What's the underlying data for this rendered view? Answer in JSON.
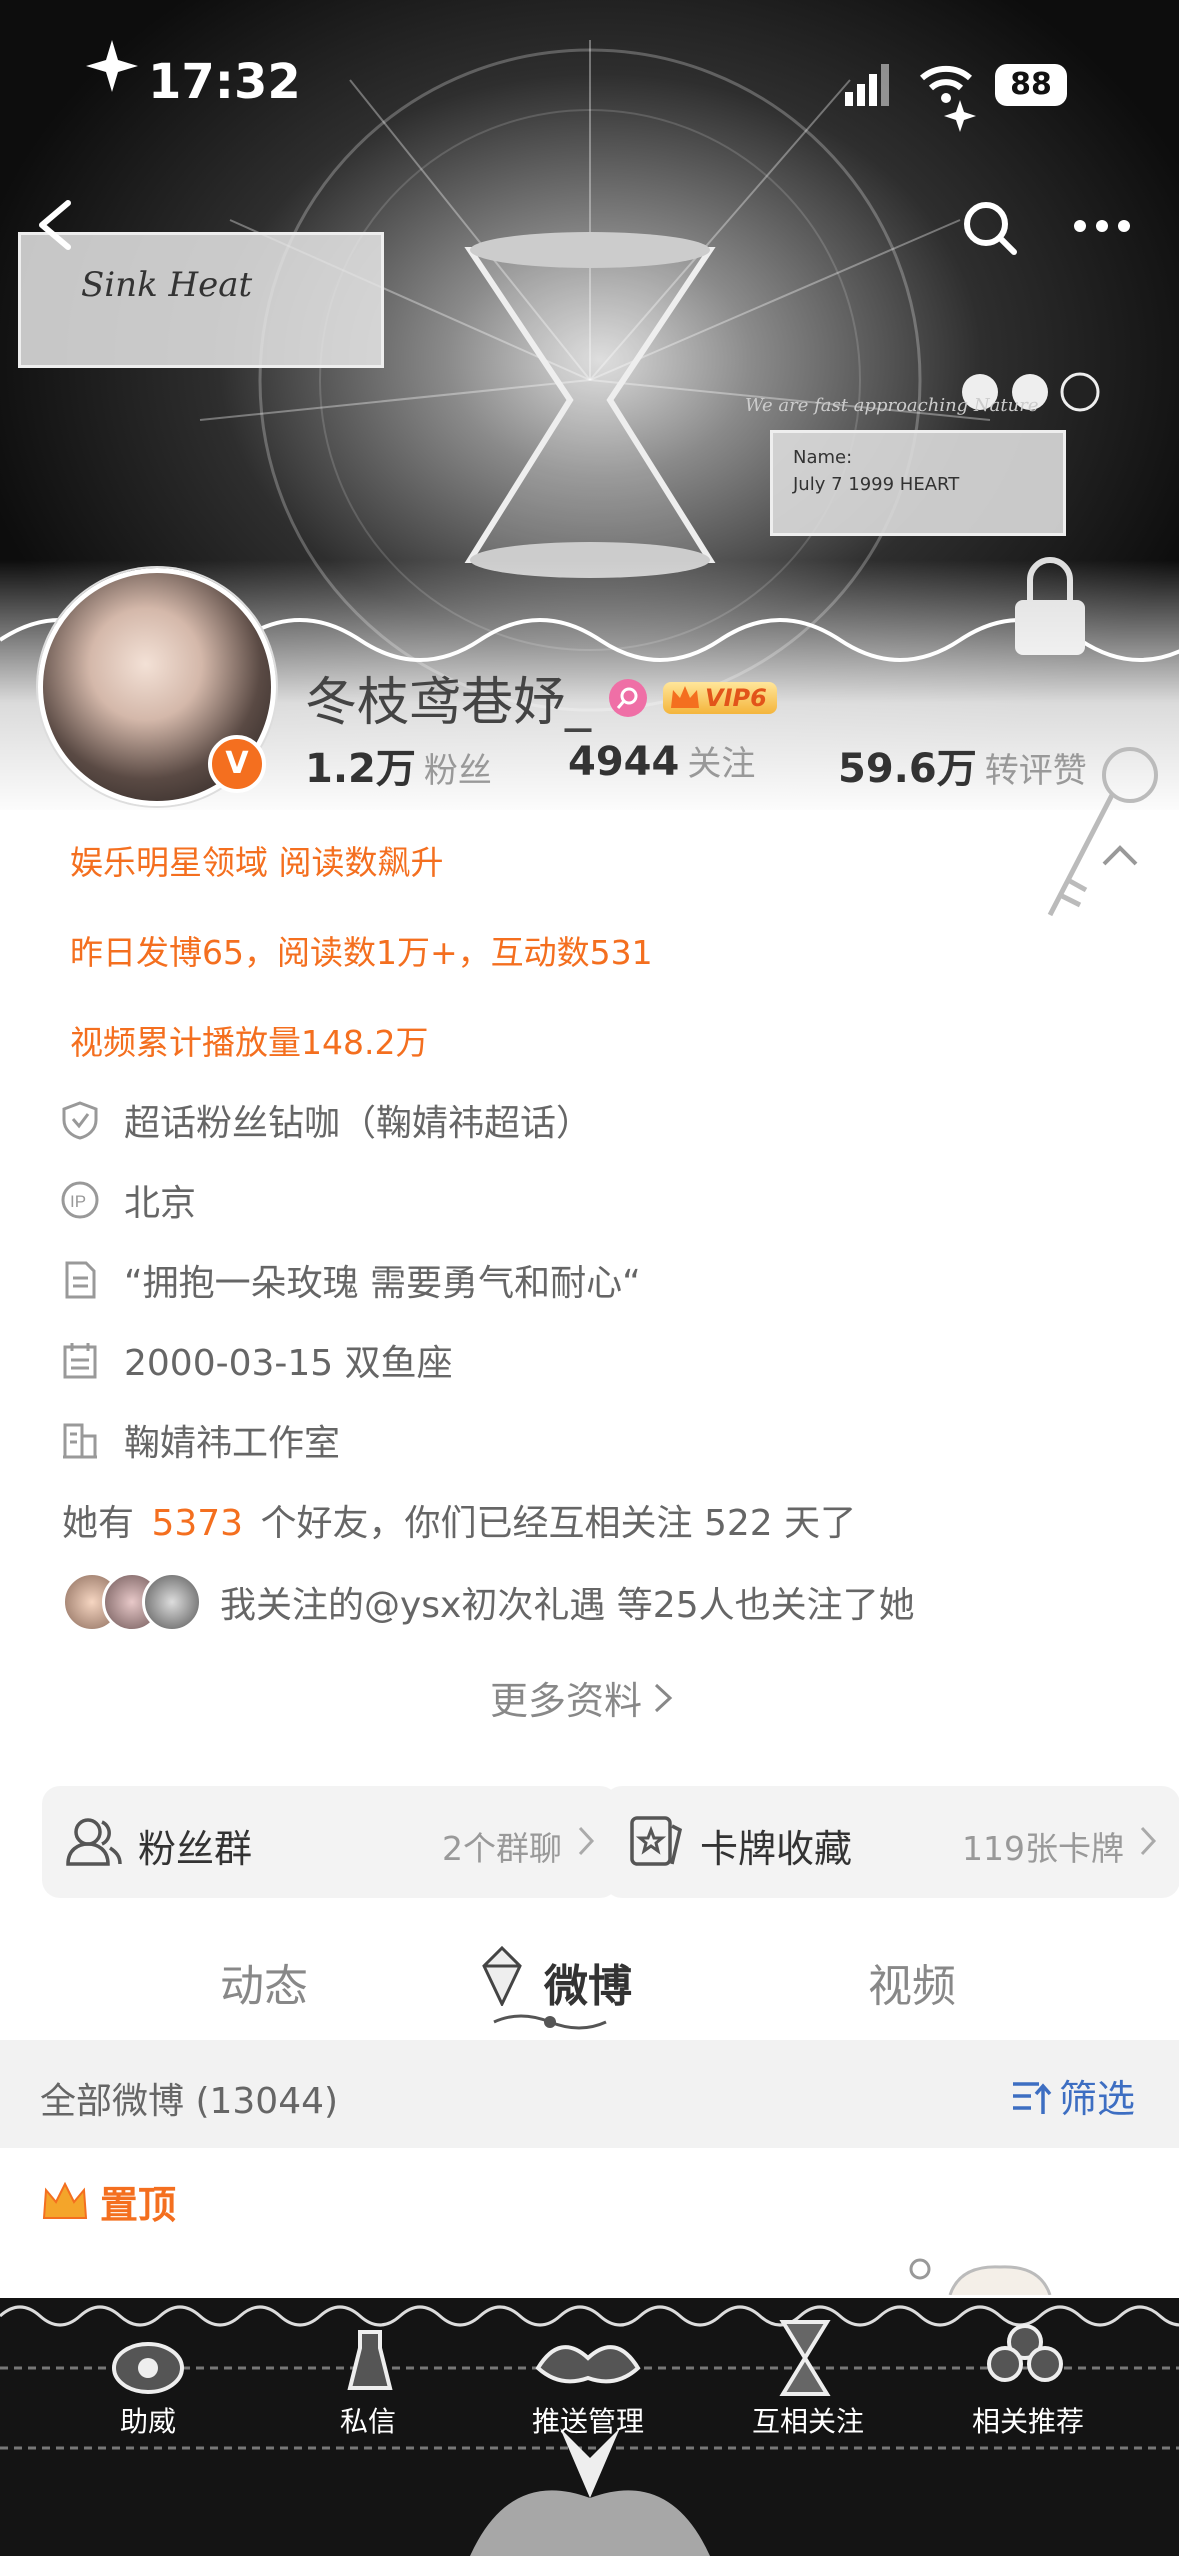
{
  "status_bar": {
    "time": "17:32",
    "battery": "88"
  },
  "banner_text": {
    "ticket": "Sink Heat",
    "caption": "We are fast approaching Nature",
    "card_name": "Name:",
    "card_date": "July 7 1999 HEART"
  },
  "profile": {
    "name": "冬枝鸢巷妤_",
    "vip": "VIP6",
    "verified": "V",
    "stats": [
      {
        "num": "1.2万",
        "label": "粉丝"
      },
      {
        "num": "4944",
        "label": "关注"
      },
      {
        "num": "59.6万",
        "label": "转评赞"
      }
    ]
  },
  "highlights": [
    "娱乐明星领域 阅读数飙升",
    "昨日发博65，阅读数1万+，互动数531",
    "视频累计播放量148.2万"
  ],
  "info": [
    {
      "icon": "shield-icon",
      "text": "超话粉丝钻咖（鞠婧祎超话）"
    },
    {
      "icon": "ip-icon",
      "text": "北京"
    },
    {
      "icon": "document-icon",
      "text": "“拥抱一朵玫瑰 需要勇气和耐心“"
    },
    {
      "icon": "calendar-icon",
      "text": "2000-03-15 双鱼座"
    },
    {
      "icon": "company-icon",
      "text": "鞠婧祎工作室"
    }
  ],
  "friends": {
    "prefix": "她有",
    "count": "5373",
    "suffix": "个好友，你们已经互相关注 522 天了"
  },
  "mutual_follow": "我关注的@ysx初次礼遇 等25人也关注了她",
  "more_info": "更多资料",
  "cards": [
    {
      "title": "粉丝群",
      "meta": "2个群聊"
    },
    {
      "title": "卡牌收藏",
      "meta": "119张卡牌"
    }
  ],
  "tabs": [
    "动态",
    "微博",
    "视频"
  ],
  "filter_bar": {
    "all": "全部微博 (13044)",
    "filter": "筛选"
  },
  "pinned": "置顶",
  "bottom_nav": [
    "助威",
    "私信",
    "推送管理",
    "互相关注",
    "相关推荐"
  ],
  "colors": {
    "accent": "#f46f1f",
    "filter_blue": "#3d6ec2"
  }
}
